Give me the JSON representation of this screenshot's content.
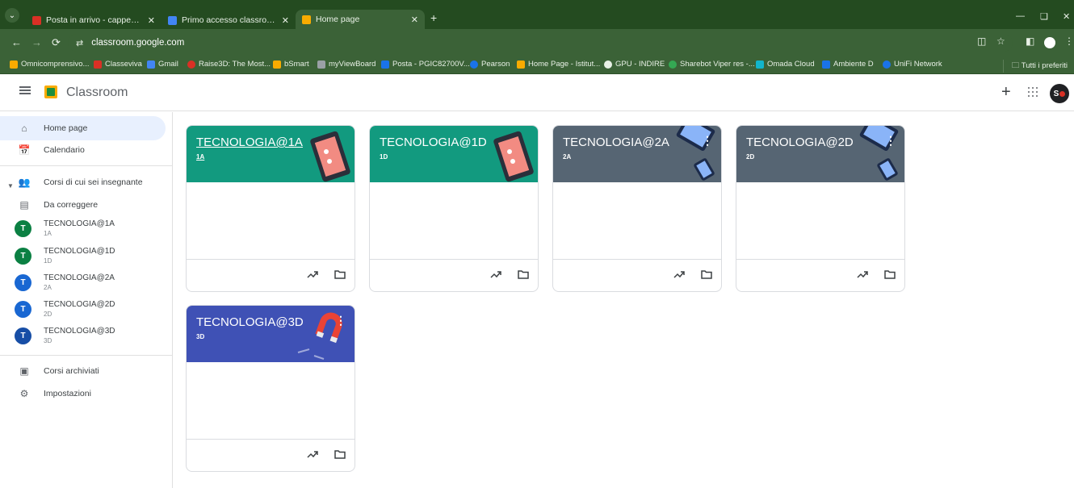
{
  "browser": {
    "tabs": [
      {
        "title": "Posta in arrivo - cappellistefanc",
        "icon": "gmail-icon",
        "color": "#d93025"
      },
      {
        "title": "Primo accesso classroom.docx",
        "icon": "docs-icon",
        "color": "#4285f4"
      },
      {
        "title": "Home page",
        "icon": "classroom-icon",
        "color": "#f9ab00"
      }
    ],
    "url": "classroom.google.com",
    "bookmarks": [
      {
        "label": "Omnicomprensivo...",
        "color": "#f9ab00"
      },
      {
        "label": "Classeviva",
        "color": "#d93025"
      },
      {
        "label": "Gmail",
        "color": "#4285f4"
      },
      {
        "label": "Raise3D: The Most...",
        "color": "#d93025"
      },
      {
        "label": "bSmart",
        "color": "#f9ab00"
      },
      {
        "label": "myViewBoard",
        "color": "#9aa0a6"
      },
      {
        "label": "Posta - PGIC82700V...",
        "color": "#1a73e8"
      },
      {
        "label": "Pearson",
        "color": "#1a73e8"
      },
      {
        "label": "Home Page - Istitut...",
        "color": "#f9ab00"
      },
      {
        "label": "GPU - INDIRE",
        "color": "#e8f0e6"
      },
      {
        "label": "Sharebot Viper res -...",
        "color": "#34a853"
      },
      {
        "label": "Omada Cloud",
        "color": "#12b5cb"
      },
      {
        "label": "Ambiente D",
        "color": "#1a73e8"
      },
      {
        "label": "UniFi Network",
        "color": "#1a73e8"
      }
    ],
    "bookmarks_all": "Tutti i preferiti"
  },
  "app": {
    "title": "Classroom",
    "avatar_initials": "S"
  },
  "sidebar": {
    "home": "Home page",
    "calendar": "Calendario",
    "teaching": "Corsi di cui sei insegnante",
    "to_review": "Da correggere",
    "courses": [
      {
        "initial": "T",
        "title": "TECNOLOGIA@1A",
        "section": "1A",
        "color": "#0b8043"
      },
      {
        "initial": "T",
        "title": "TECNOLOGIA@1D",
        "section": "1D",
        "color": "#0b8043"
      },
      {
        "initial": "T",
        "title": "TECNOLOGIA@2A",
        "section": "2A",
        "color": "#1967d2"
      },
      {
        "initial": "T",
        "title": "TECNOLOGIA@2D",
        "section": "2D",
        "color": "#1967d2"
      },
      {
        "initial": "T",
        "title": "TECNOLOGIA@3D",
        "section": "3D",
        "color": "#174ea6"
      }
    ],
    "archived": "Corsi archiviati",
    "settings": "Impostazioni"
  },
  "cards": [
    {
      "title": "TECNOLOGIA@1A",
      "section": "1A",
      "color": "#129a7f",
      "illustration": "tablet-illustration"
    },
    {
      "title": "TECNOLOGIA@1D",
      "section": "1D",
      "color": "#129a7f",
      "illustration": "tablet-illustration"
    },
    {
      "title": "TECNOLOGIA@2A",
      "section": "2A",
      "color": "#566573",
      "illustration": "devices-illustration"
    },
    {
      "title": "TECNOLOGIA@2D",
      "section": "2D",
      "color": "#566573",
      "illustration": "devices-illustration"
    },
    {
      "title": "TECNOLOGIA@3D",
      "section": "3D",
      "color": "#3f51b5",
      "illustration": "magnet-illustration"
    }
  ]
}
